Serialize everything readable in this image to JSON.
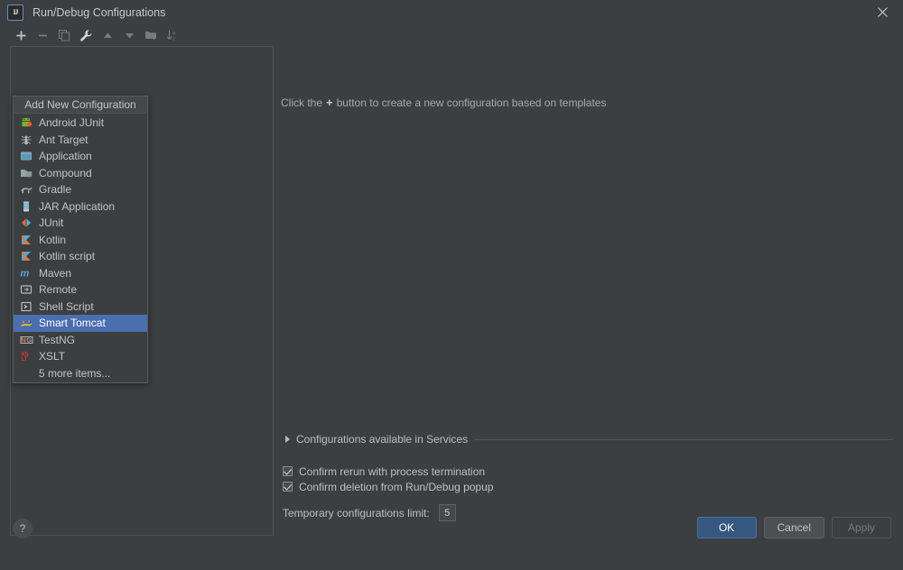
{
  "window": {
    "title": "Run/Debug Configurations",
    "app_icon": "intellij-idea-icon",
    "close_icon": "close-icon"
  },
  "toolbar": {
    "buttons": [
      {
        "name": "add-configuration-button",
        "icon": "plus-icon",
        "enabled": true
      },
      {
        "name": "remove-configuration-button",
        "icon": "minus-icon",
        "enabled": false
      },
      {
        "name": "copy-configuration-button",
        "icon": "copy-icon",
        "enabled": false
      },
      {
        "name": "edit-templates-button",
        "icon": "wrench-icon",
        "enabled": true
      },
      {
        "name": "move-up-button",
        "icon": "arrow-up-icon",
        "enabled": false
      },
      {
        "name": "move-down-button",
        "icon": "arrow-down-icon",
        "enabled": false
      },
      {
        "name": "new-folder-button",
        "icon": "folder-add-icon",
        "enabled": false
      },
      {
        "name": "sort-configurations-button",
        "icon": "sort-az-icon",
        "enabled": false
      }
    ]
  },
  "popup": {
    "header": "Add New Configuration",
    "selected_index": 12,
    "items": [
      {
        "label": "Android JUnit",
        "icon": "android-junit-icon"
      },
      {
        "label": "Ant Target",
        "icon": "ant-target-icon"
      },
      {
        "label": "Application",
        "icon": "application-icon"
      },
      {
        "label": "Compound",
        "icon": "compound-icon"
      },
      {
        "label": "Gradle",
        "icon": "gradle-icon"
      },
      {
        "label": "JAR Application",
        "icon": "jar-application-icon"
      },
      {
        "label": "JUnit",
        "icon": "junit-icon"
      },
      {
        "label": "Kotlin",
        "icon": "kotlin-icon"
      },
      {
        "label": "Kotlin script",
        "icon": "kotlin-script-icon"
      },
      {
        "label": "Maven",
        "icon": "maven-icon"
      },
      {
        "label": "Remote",
        "icon": "remote-icon"
      },
      {
        "label": "Shell Script",
        "icon": "shell-script-icon"
      },
      {
        "label": "Smart Tomcat",
        "icon": "smart-tomcat-icon"
      },
      {
        "label": "TestNG",
        "icon": "testng-icon"
      },
      {
        "label": "XSLT",
        "icon": "xslt-icon"
      }
    ],
    "more_items": "5 more items..."
  },
  "main": {
    "hint_prefix": "Click the",
    "hint_plus": "+",
    "hint_suffix": "button to create a new configuration based on templates",
    "services_label": "Configurations available in Services",
    "services_expander_icon": "triangle-right-icon",
    "checkboxes": [
      {
        "label": "Confirm rerun with process termination",
        "checked": true
      },
      {
        "label": "Confirm deletion from Run/Debug popup",
        "checked": true
      }
    ],
    "temp_limit_label": "Temporary configurations limit:",
    "temp_limit_value": "5"
  },
  "footer": {
    "help_label": "?",
    "ok_label": "OK",
    "cancel_label": "Cancel",
    "apply_label": "Apply"
  },
  "colors": {
    "dialog_bg": "#3c3f41",
    "selection_blue": "#4b6eaf",
    "primary_button": "#365880",
    "text": "#bbbbbb"
  }
}
